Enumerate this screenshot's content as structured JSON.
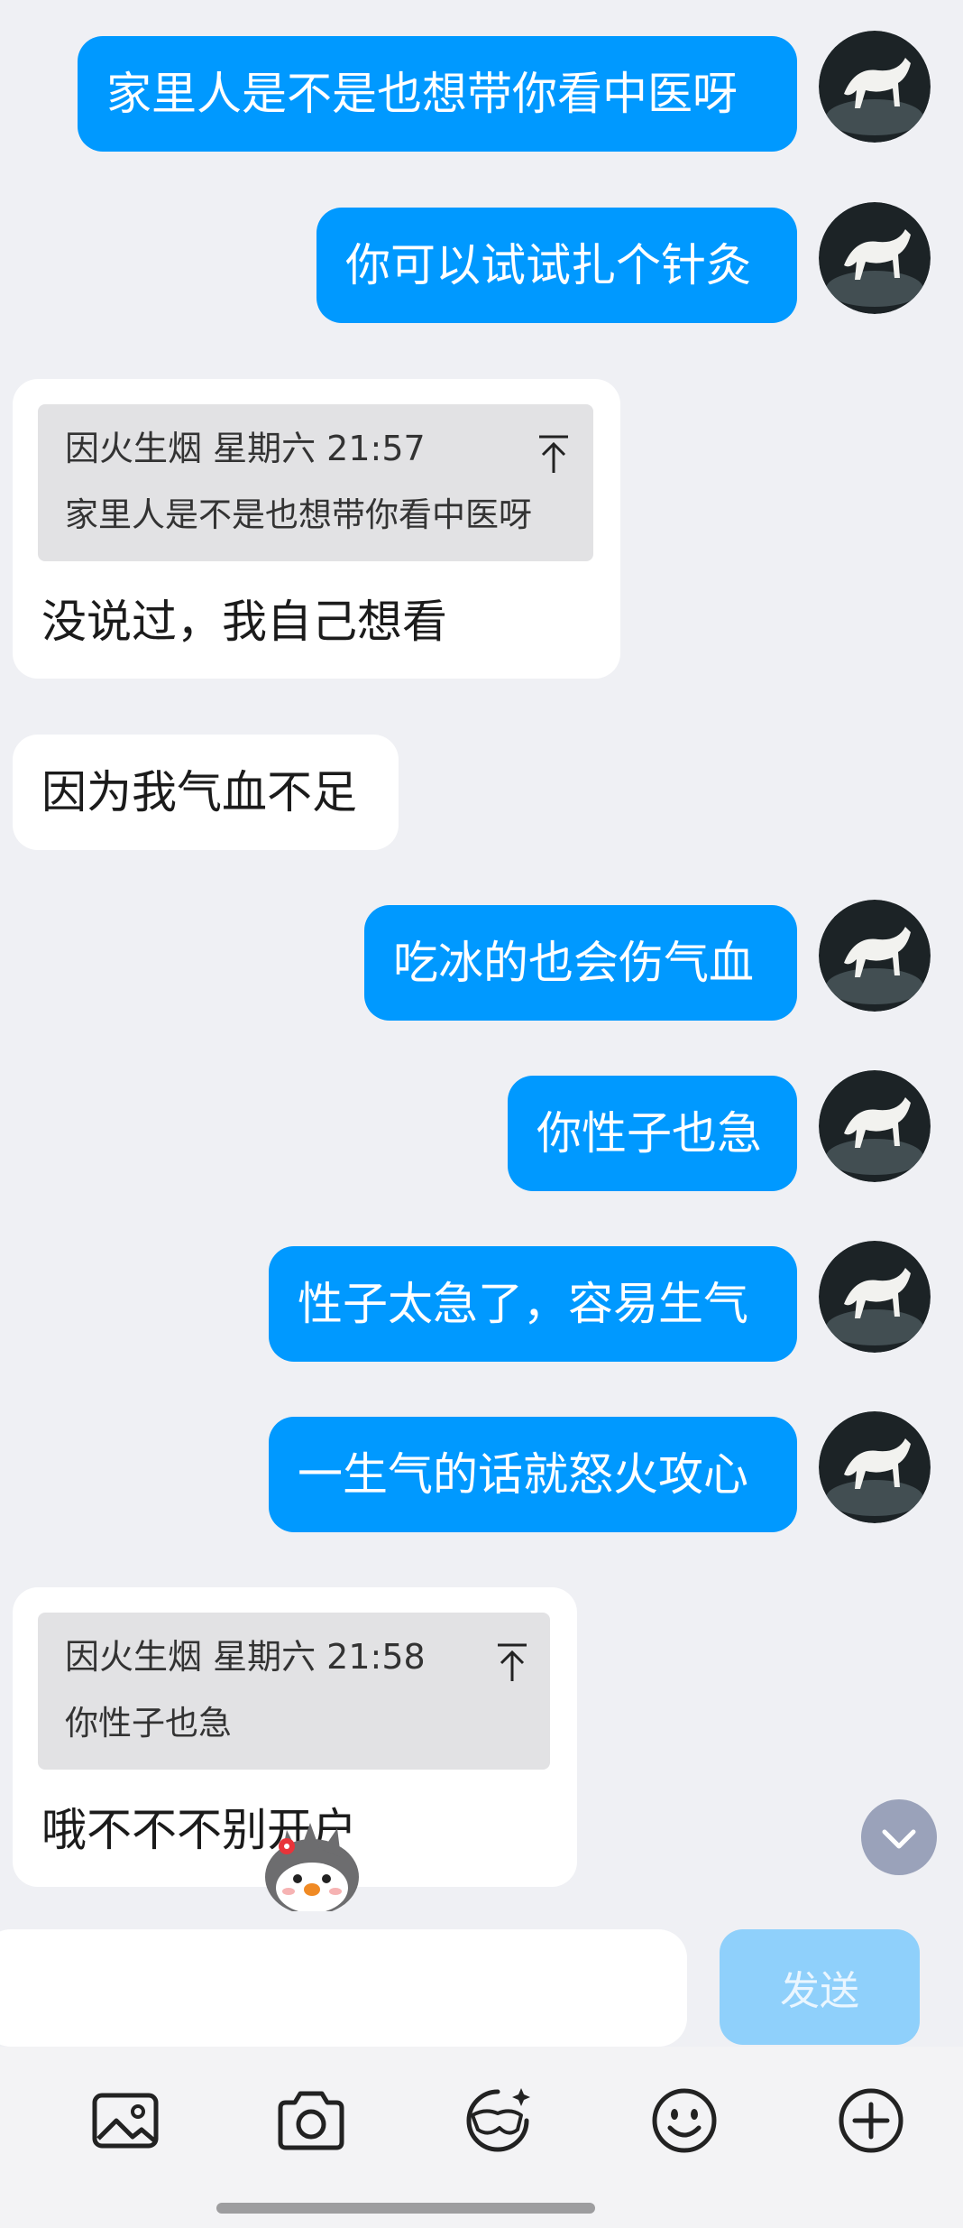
{
  "messages": [
    {
      "side": "out",
      "text": "家里人是不是也想带你看中医呀"
    },
    {
      "side": "out",
      "text": "你可以试试扎个针灸"
    },
    {
      "side": "in",
      "quote": {
        "sender": "因火生烟",
        "time": "星期六 21:57",
        "text": "家里人是不是也想带你看中医呀"
      },
      "text": "没说过，我自己想看"
    },
    {
      "side": "in",
      "text": "因为我气血不足"
    },
    {
      "side": "out",
      "text": "吃冰的也会伤气血"
    },
    {
      "side": "out",
      "text": "你性子也急"
    },
    {
      "side": "out",
      "text": "性子太急了，容易生气"
    },
    {
      "side": "out",
      "text": "一生气的话就怒火攻心"
    },
    {
      "side": "in",
      "quote": {
        "sender": "因火生烟",
        "time": "星期六 21:58",
        "text": "你性子也急"
      },
      "text": "哦不不不别开户"
    }
  ],
  "quote1": {
    "meta": "因火生烟 星期六 21:57",
    "text": "家里人是不是也想带你看中医呀"
  },
  "quote2": {
    "meta": "因火生烟 星期六 21:58",
    "text": "你性子也急"
  },
  "input": {
    "value": "",
    "placeholder": ""
  },
  "send_label": "发送",
  "toolbar": [
    "image-icon",
    "camera-icon",
    "sticker-icon",
    "emoji-icon",
    "plus-icon"
  ],
  "colors": {
    "out_bubble": "#0099ff",
    "in_bubble": "#ffffff",
    "background": "#eff0f4",
    "send_disabled": "#8fd0fb"
  }
}
